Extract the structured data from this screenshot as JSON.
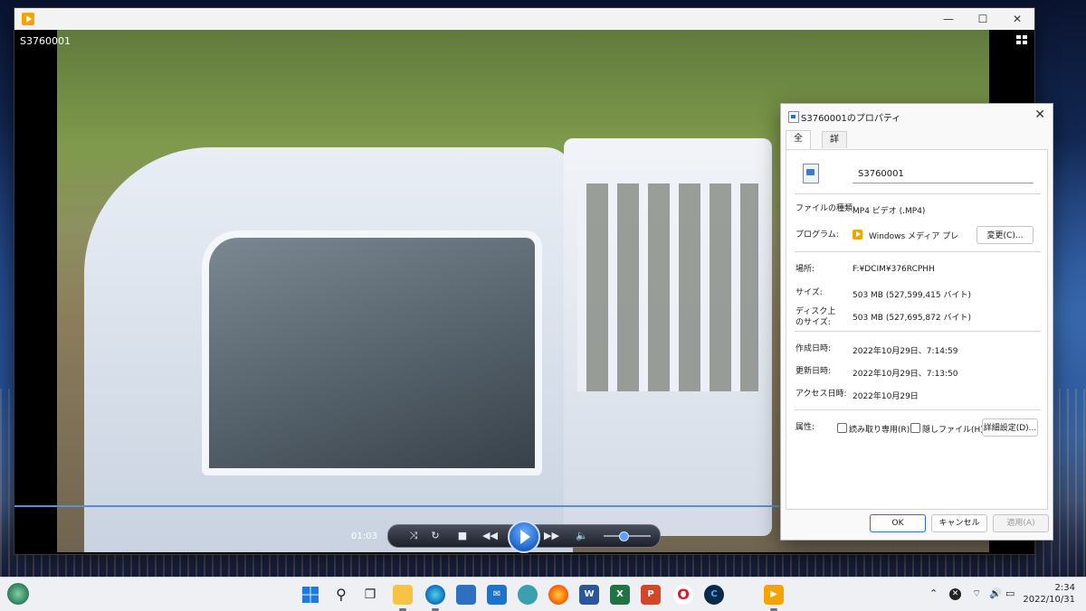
{
  "player": {
    "title": "S3760001",
    "window_controls": {
      "minimize": "—",
      "maximize": "☐",
      "close": "✕"
    },
    "time": "01:03"
  },
  "properties": {
    "title": "S3760001のプロパティ",
    "tabs": [
      "全般",
      "詳細"
    ],
    "file_name": "S3760001",
    "file_type_label": "ファイルの種類:",
    "file_type_value": "MP4 ビデオ (.MP4)",
    "program_label": "プログラム:",
    "program_value": "Windows メディア プレーヤー従来",
    "change_button": "変更(C)...",
    "location_label": "場所:",
    "location_value": "F:¥DCIM¥376RCPHH",
    "size_label": "サイズ:",
    "size_value": "503 MB (527,599,415 バイト)",
    "size_on_disk_label_1": "ディスク上",
    "size_on_disk_label_2": "のサイズ:",
    "size_on_disk_value": "503 MB (527,695,872 バイト)",
    "created_label": "作成日時:",
    "created_value": "2022年10月29日、7:14:59",
    "modified_label": "更新日時:",
    "modified_value": "2022年10月29日、7:13:50",
    "accessed_label": "アクセス日時:",
    "accessed_value": "2022年10月29日",
    "attributes_label": "属性:",
    "readonly_label": "読み取り専用(R)",
    "hidden_label": "隠しファイル(H)",
    "advanced_button": "詳細設定(D)...",
    "ok_button": "OK",
    "cancel_button": "キャンセル",
    "apply_button": "適用(A)"
  },
  "taskbar": {
    "time": "2:34",
    "date": "2022/10/31"
  },
  "colors": {
    "accent": "#2a6fd8",
    "player_orange": "#f5a300",
    "progress": "#5a8fd6"
  }
}
